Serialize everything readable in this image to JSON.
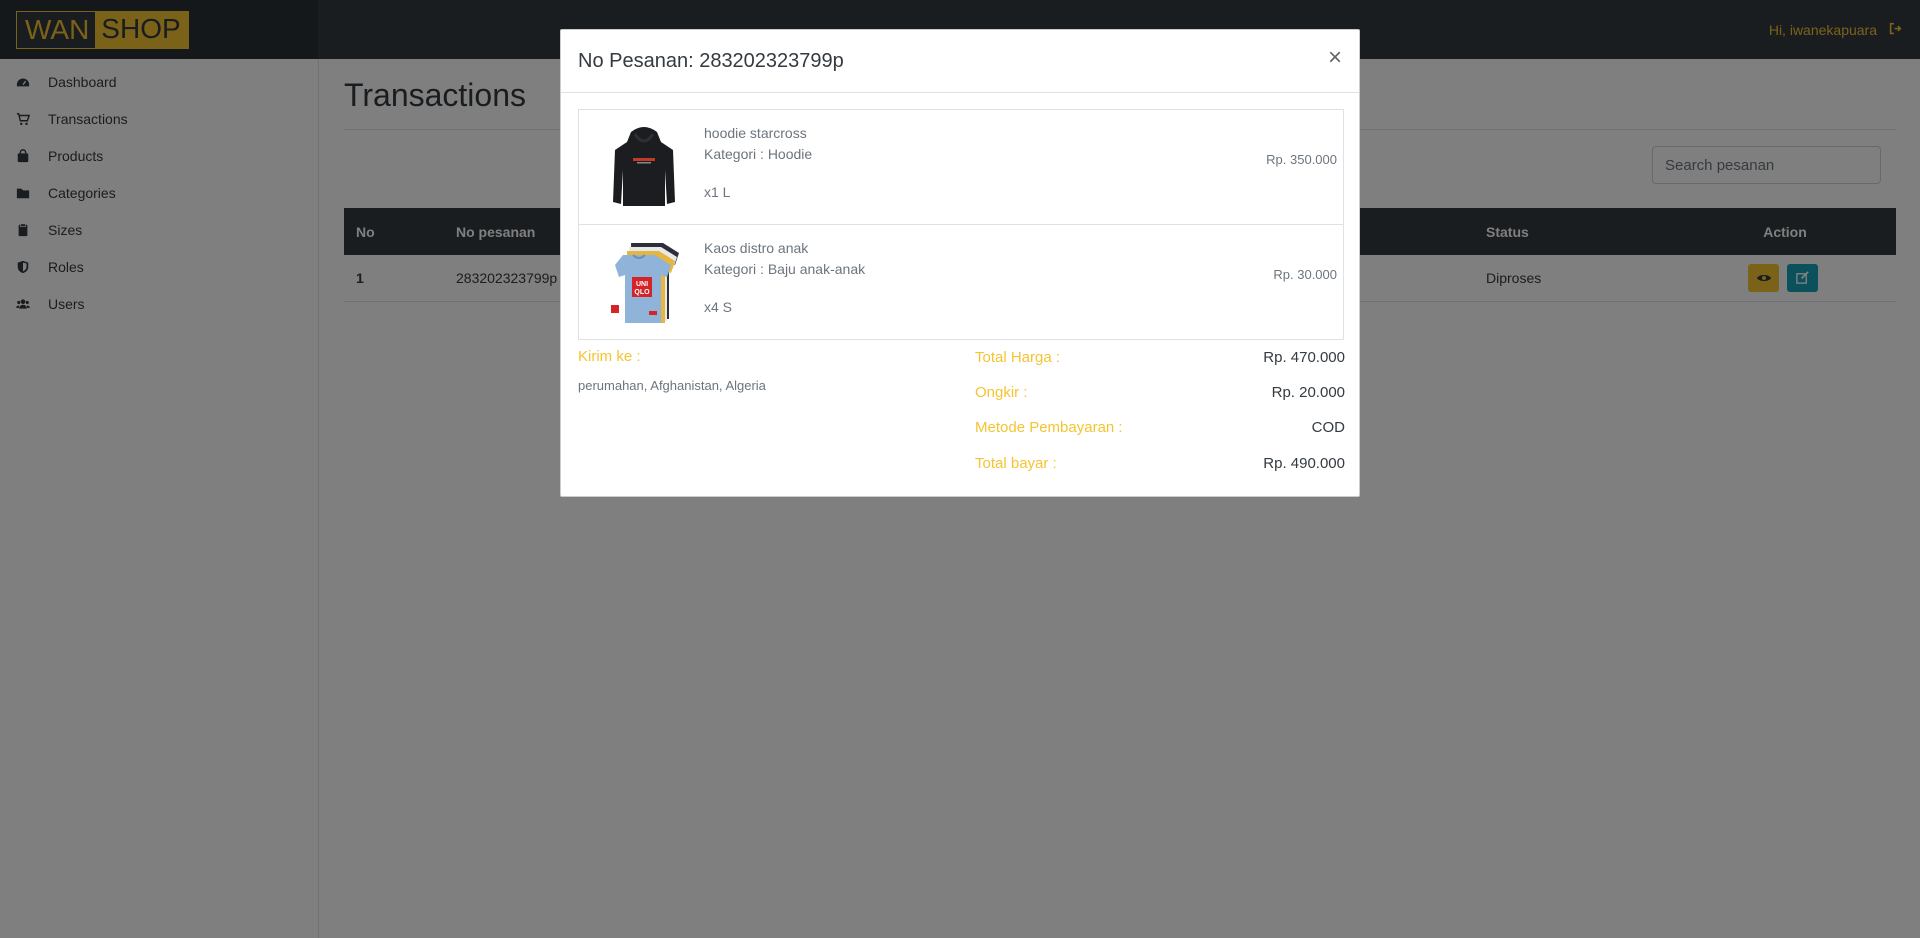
{
  "brand": {
    "part1": "WAN",
    "part2": "SHOP"
  },
  "user": {
    "greeting": "Hi, iwanekapuara"
  },
  "sidebar": {
    "items": [
      {
        "label": "Dashboard",
        "icon": "dashboard-icon"
      },
      {
        "label": "Transactions",
        "icon": "cart-icon"
      },
      {
        "label": "Products",
        "icon": "bag-icon"
      },
      {
        "label": "Categories",
        "icon": "folder-icon"
      },
      {
        "label": "Sizes",
        "icon": "clipboard-icon"
      },
      {
        "label": "Roles",
        "icon": "shield-icon"
      },
      {
        "label": "Users",
        "icon": "users-icon"
      }
    ]
  },
  "main": {
    "title": "Transactions",
    "search_placeholder": "Search pesanan",
    "table": {
      "headers": {
        "no": "No",
        "order": "No pesanan",
        "status": "Status",
        "action": "Action"
      },
      "rows": [
        {
          "no": "1",
          "order": "283202323799p",
          "status": "Diproses"
        }
      ]
    }
  },
  "modal": {
    "title": "No Pesanan: 283202323799p",
    "close": "×",
    "items": [
      {
        "name": "hoodie starcross",
        "category": "Kategori : Hoodie",
        "qty": "x1 L",
        "price": "Rp. 350.000"
      },
      {
        "name": "Kaos distro anak",
        "category": "Kategori : Baju anak-anak",
        "qty": "x4 S",
        "price": "Rp. 30.000"
      }
    ],
    "shipping": {
      "label": "Kirim ke :",
      "address": "perumahan, Afghanistan, Algeria"
    },
    "summary": {
      "total_label": "Total Harga :",
      "total_value": "Rp. 470.000",
      "ongkir_label": "Ongkir :",
      "ongkir_value": "Rp. 20.000",
      "method_label": "Metode Pembayaran :",
      "method_value": "COD",
      "pay_label": "Total bayar :",
      "pay_value": "Rp. 490.000"
    }
  },
  "colors": {
    "accent": "#f5c431",
    "dark": "#343a40",
    "teal": "#17a2b8",
    "danger": "#dc3545"
  }
}
